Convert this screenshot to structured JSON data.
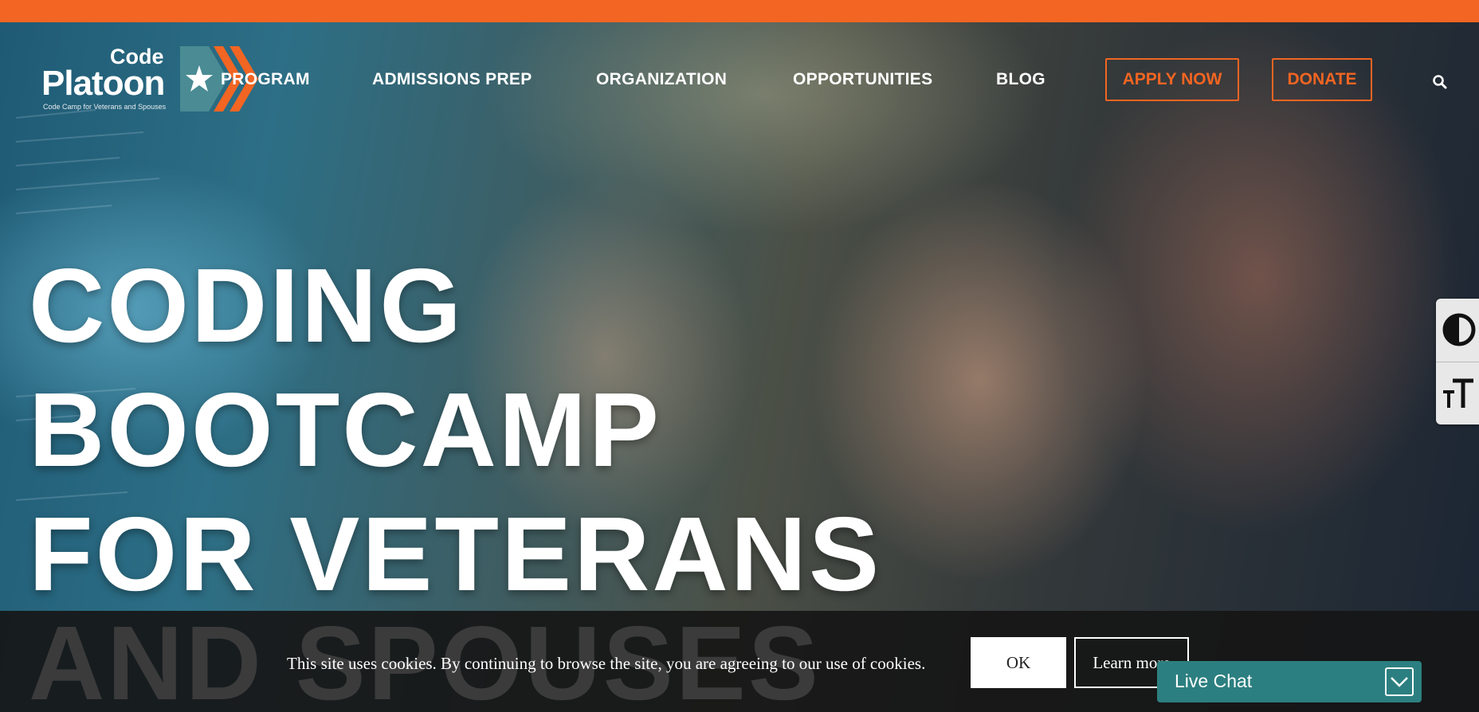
{
  "logo": {
    "line1": "Code",
    "line2": "Platoon",
    "tagline": "Code Camp for Veterans and Spouses"
  },
  "nav": {
    "items": [
      {
        "label": "PROGRAM"
      },
      {
        "label": "ADMISSIONS PREP"
      },
      {
        "label": "ORGANIZATION"
      },
      {
        "label": "OPPORTUNITIES"
      },
      {
        "label": "BLOG"
      }
    ],
    "apply_label": "APPLY NOW",
    "donate_label": "DONATE"
  },
  "hero": {
    "line1": "CODING",
    "line2": "BOOTCAMP",
    "line3": "FOR VETERANS",
    "line4": "AND SPOUSES"
  },
  "cookie": {
    "message": "This site uses cookies. By continuing to browse the site, you are agreeing to our use of cookies.",
    "ok_label": "OK",
    "learn_label": "Learn more"
  },
  "live_chat": {
    "label": "Live Chat"
  },
  "icons": {
    "search": "search-icon",
    "contrast": "contrast-icon",
    "text_size": "text-size-icon",
    "chat_toggle": "chevron-down-icon"
  },
  "colors": {
    "accent": "#f26522",
    "chat": "#2c7f80",
    "logo_mark": "#4a8b94"
  }
}
